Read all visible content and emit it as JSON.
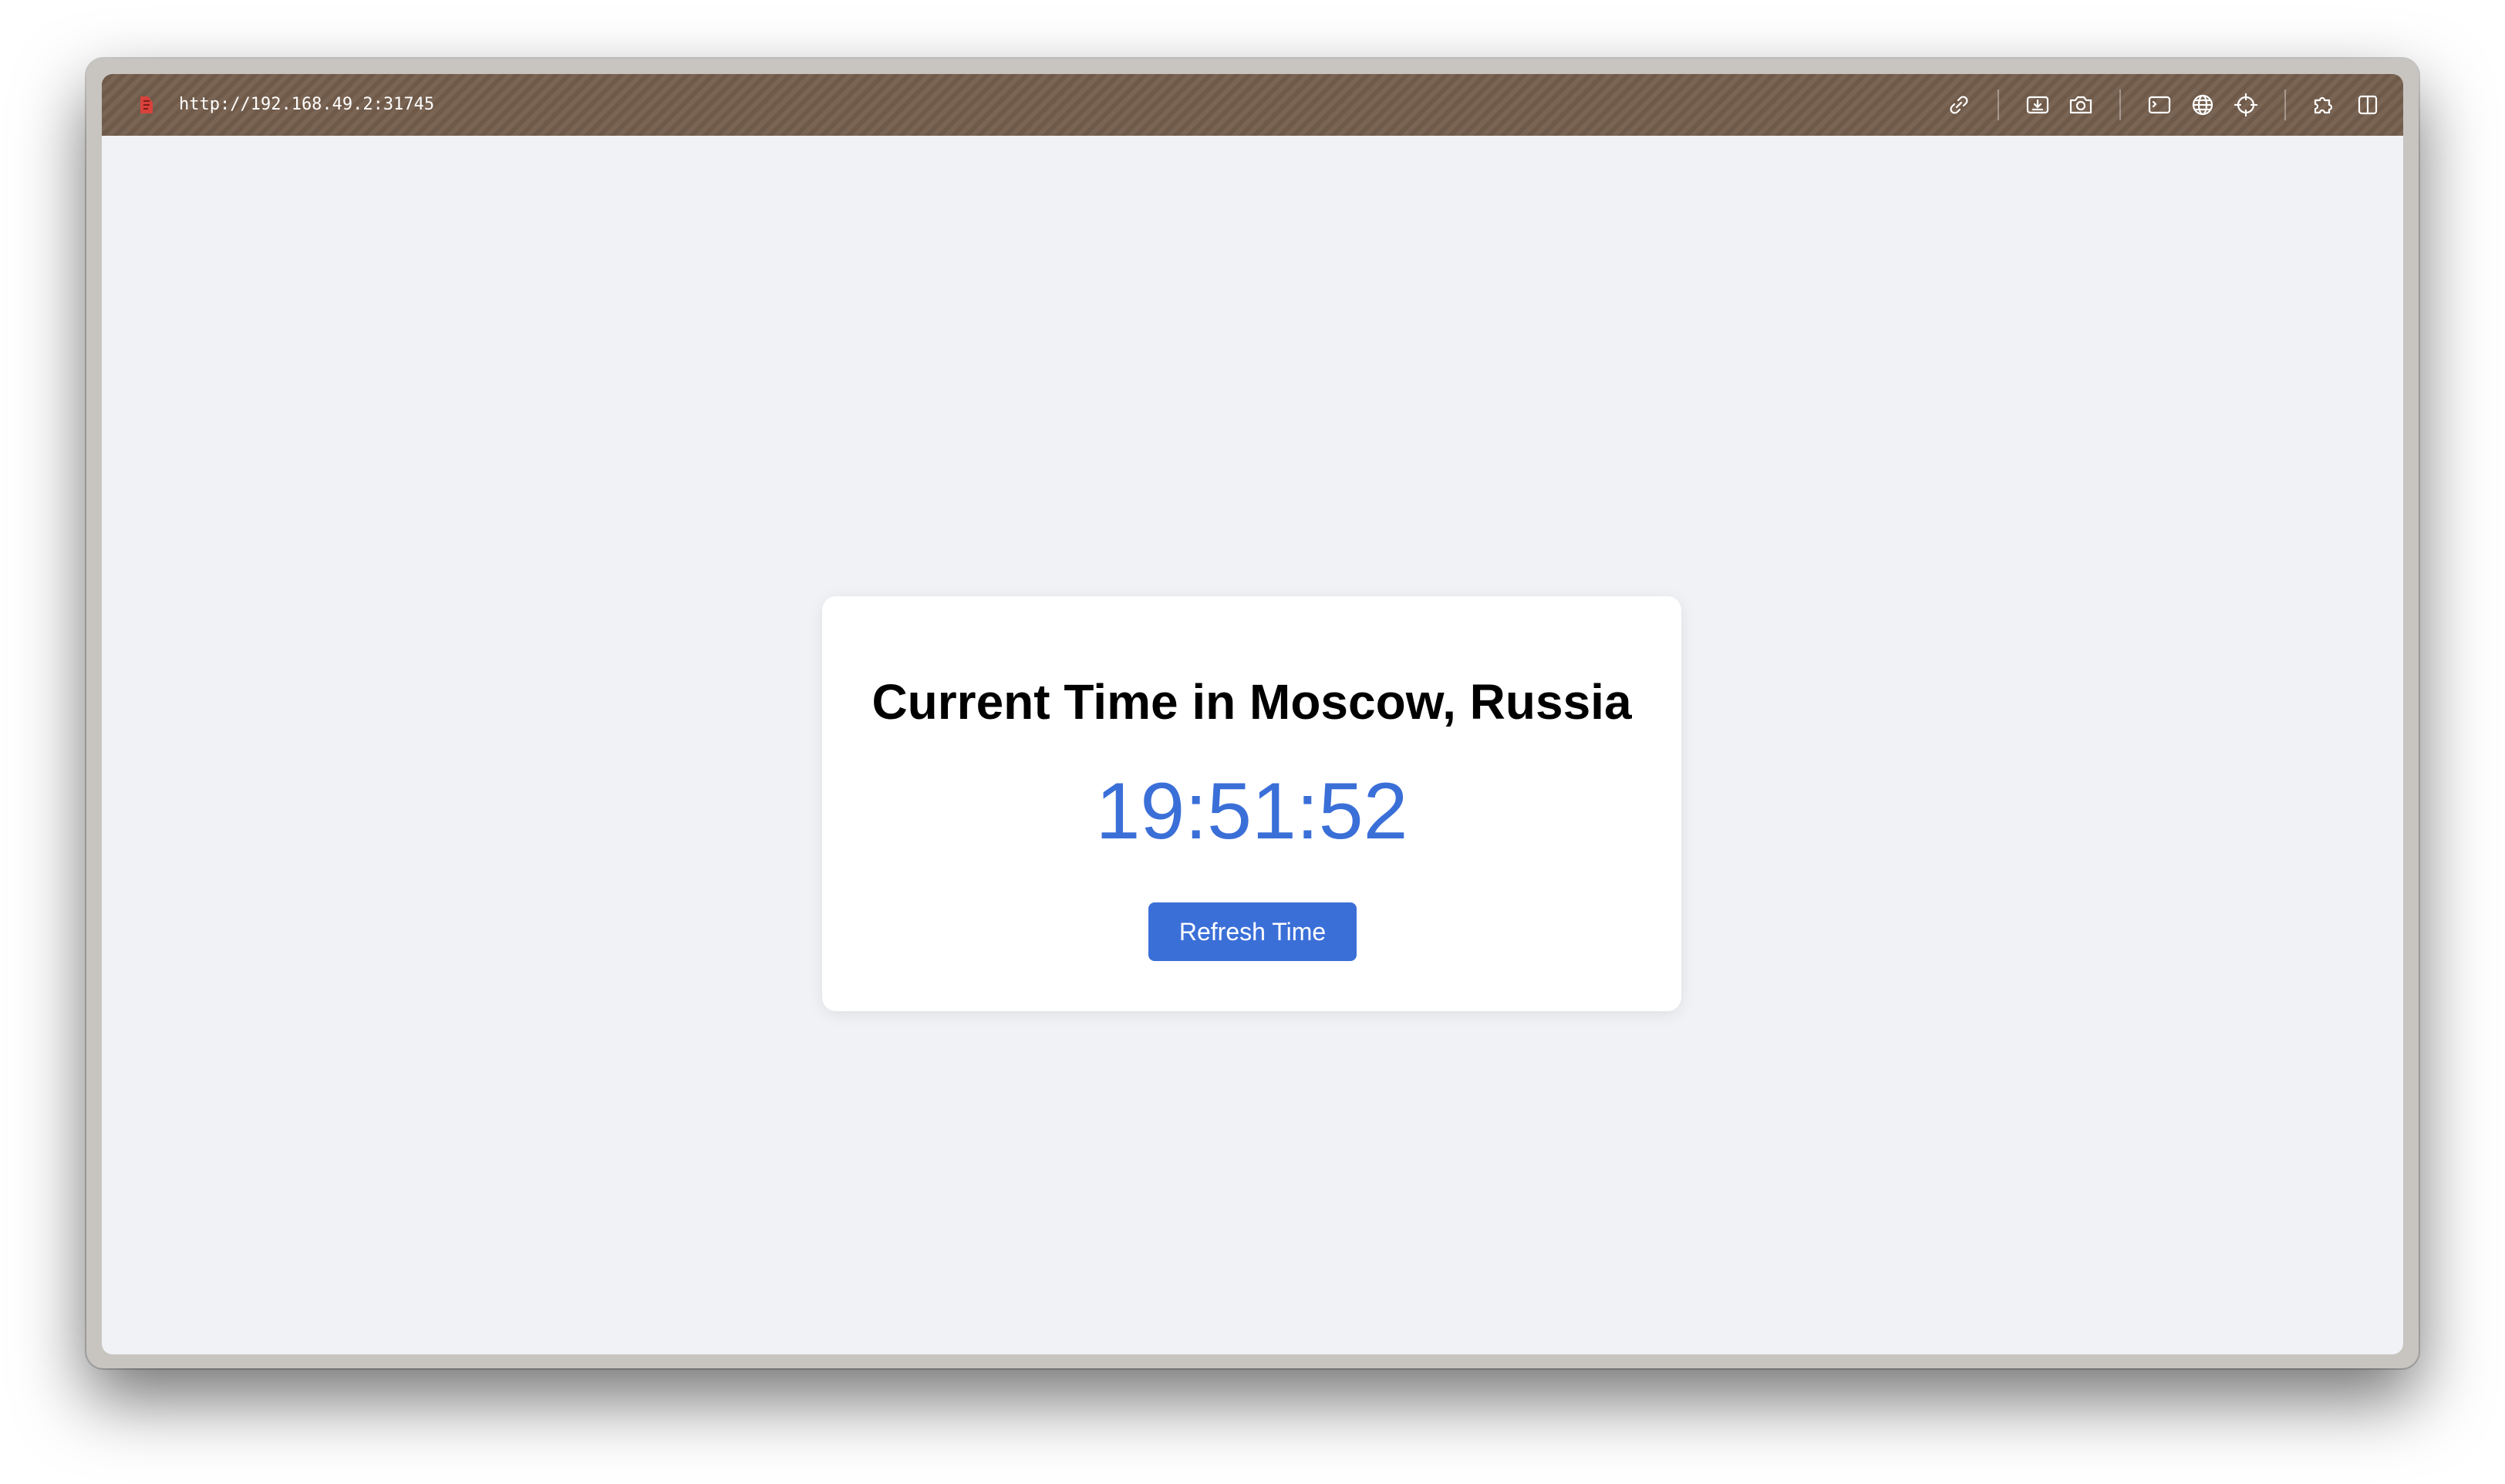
{
  "browser": {
    "url": "http://192.168.49.2:31745",
    "toolbar_icons": [
      "link-icon",
      "download-icon",
      "camera-icon",
      "terminal-icon",
      "globe-icon",
      "crosshair-icon",
      "extension-icon",
      "split-view-icon"
    ]
  },
  "page": {
    "title": "Current Time in Moscow, Russia",
    "time": "19:51:52",
    "refresh_label": "Refresh Time"
  },
  "colors": {
    "accent": "#3b6fd8",
    "background": "#f0f2f5",
    "titlebar": "#7a6453"
  }
}
